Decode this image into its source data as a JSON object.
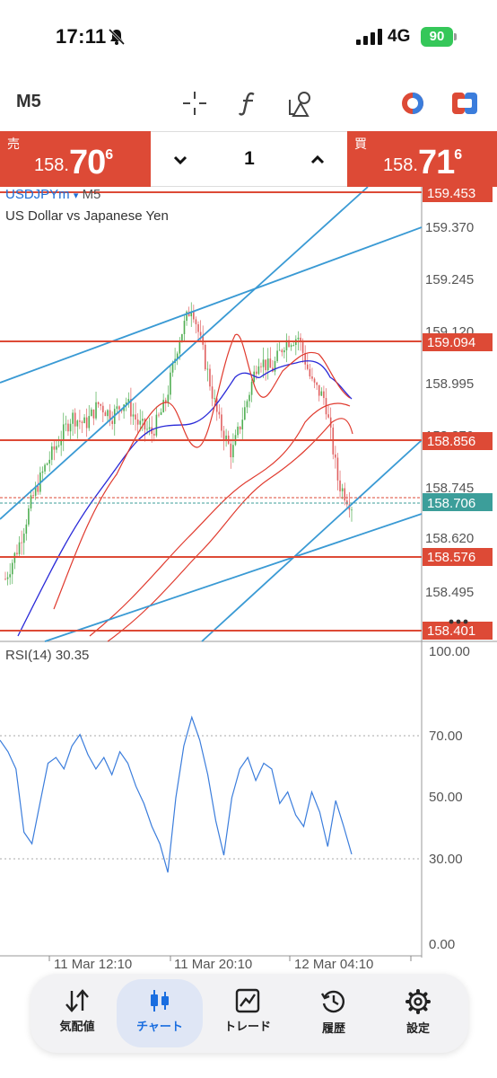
{
  "status_bar": {
    "time": "17:11",
    "network": "4G",
    "battery": "90"
  },
  "toolbar": {
    "timeframe": "M5",
    "icons": [
      "crosshair-icon",
      "function-f-icon",
      "drawing-shapes-icon",
      "color-theme-icon",
      "trade-toggle-icon"
    ]
  },
  "trade": {
    "sell_label": "売",
    "sell_price_prefix": "158.",
    "sell_price_big": "70",
    "sell_price_sup": "6",
    "buy_label": "買",
    "buy_price_prefix": "158.",
    "buy_price_big": "71",
    "buy_price_sup": "6",
    "lot": "1"
  },
  "chart": {
    "symbol": "USDJPYm",
    "symbol_marker": "▾",
    "timeframe": "M5",
    "description": "US Dollar vs Japanese Yen",
    "price_axis": [
      "159.370",
      "159.245",
      "159.120",
      "158.995",
      "158.870",
      "158.745",
      "158.620",
      "158.495"
    ],
    "price_tags": [
      "159.453",
      "159.094",
      "158.856",
      "158.576",
      "158.401"
    ],
    "current_tag": "158.706",
    "time_axis": [
      "11 Mar 12:10",
      "11 Mar 20:10",
      "12 Mar 04:10"
    ],
    "colors": {
      "level_line": "#dd4a36",
      "trendline": "#3a9ad4",
      "ma_fast": "#e03a2e",
      "ma_slow": "#2a2ad8",
      "current_tag": "#3c9e9a"
    }
  },
  "rsi": {
    "label": "RSI(14)",
    "value": "30.35",
    "axis": [
      "100.00",
      "70.00",
      "50.00",
      "30.00",
      "0.00"
    ],
    "line_color": "#3b7ddc"
  },
  "chart_data": [
    {
      "type": "line",
      "title": "USDJPYm M5",
      "subtitle": "US Dollar vs Japanese Yen",
      "xlabel": "",
      "ylabel": "",
      "x_ticks": [
        "11 Mar 12:10",
        "11 Mar 20:10",
        "12 Mar 04:10"
      ],
      "ylim": [
        158.38,
        159.47
      ],
      "horizontal_levels": [
        159.453,
        159.094,
        158.856,
        158.576,
        158.401
      ],
      "current_price": 158.706,
      "series": [
        {
          "name": "Close",
          "values": [
            158.53,
            158.61,
            158.72,
            158.8,
            158.86,
            158.92,
            158.9,
            158.95,
            158.92,
            158.96,
            158.9,
            158.88,
            158.95,
            159.1,
            159.19,
            159.05,
            158.91,
            158.83,
            158.94,
            159.06,
            159.03,
            159.1,
            159.11,
            159.0,
            158.96,
            158.76,
            158.706
          ]
        }
      ]
    },
    {
      "type": "line",
      "title": "RSI(14) 30.35",
      "ylim": [
        0,
        100
      ],
      "y_ticks": [
        100,
        70,
        50,
        30,
        0
      ],
      "series": [
        {
          "name": "RSI(14)",
          "values": [
            70,
            66,
            60,
            38,
            34,
            48,
            62,
            64,
            60,
            68,
            72,
            65,
            60,
            64,
            58,
            66,
            62,
            54,
            48,
            40,
            34,
            24,
            50,
            68,
            78,
            70,
            58,
            42,
            30,
            50,
            60,
            64,
            56,
            62,
            60,
            48,
            52,
            44,
            40,
            52,
            45,
            33,
            49,
            40,
            30.35
          ]
        }
      ]
    }
  ],
  "nav": [
    {
      "label": "気配値",
      "icon": "quotes-arrows-icon",
      "active": false
    },
    {
      "label": "チャート",
      "icon": "candlestick-icon",
      "active": true
    },
    {
      "label": "トレード",
      "icon": "trade-chart-icon",
      "active": false
    },
    {
      "label": "履歴",
      "icon": "history-clock-icon",
      "active": false
    },
    {
      "label": "設定",
      "icon": "settings-gear-icon",
      "active": false
    }
  ]
}
